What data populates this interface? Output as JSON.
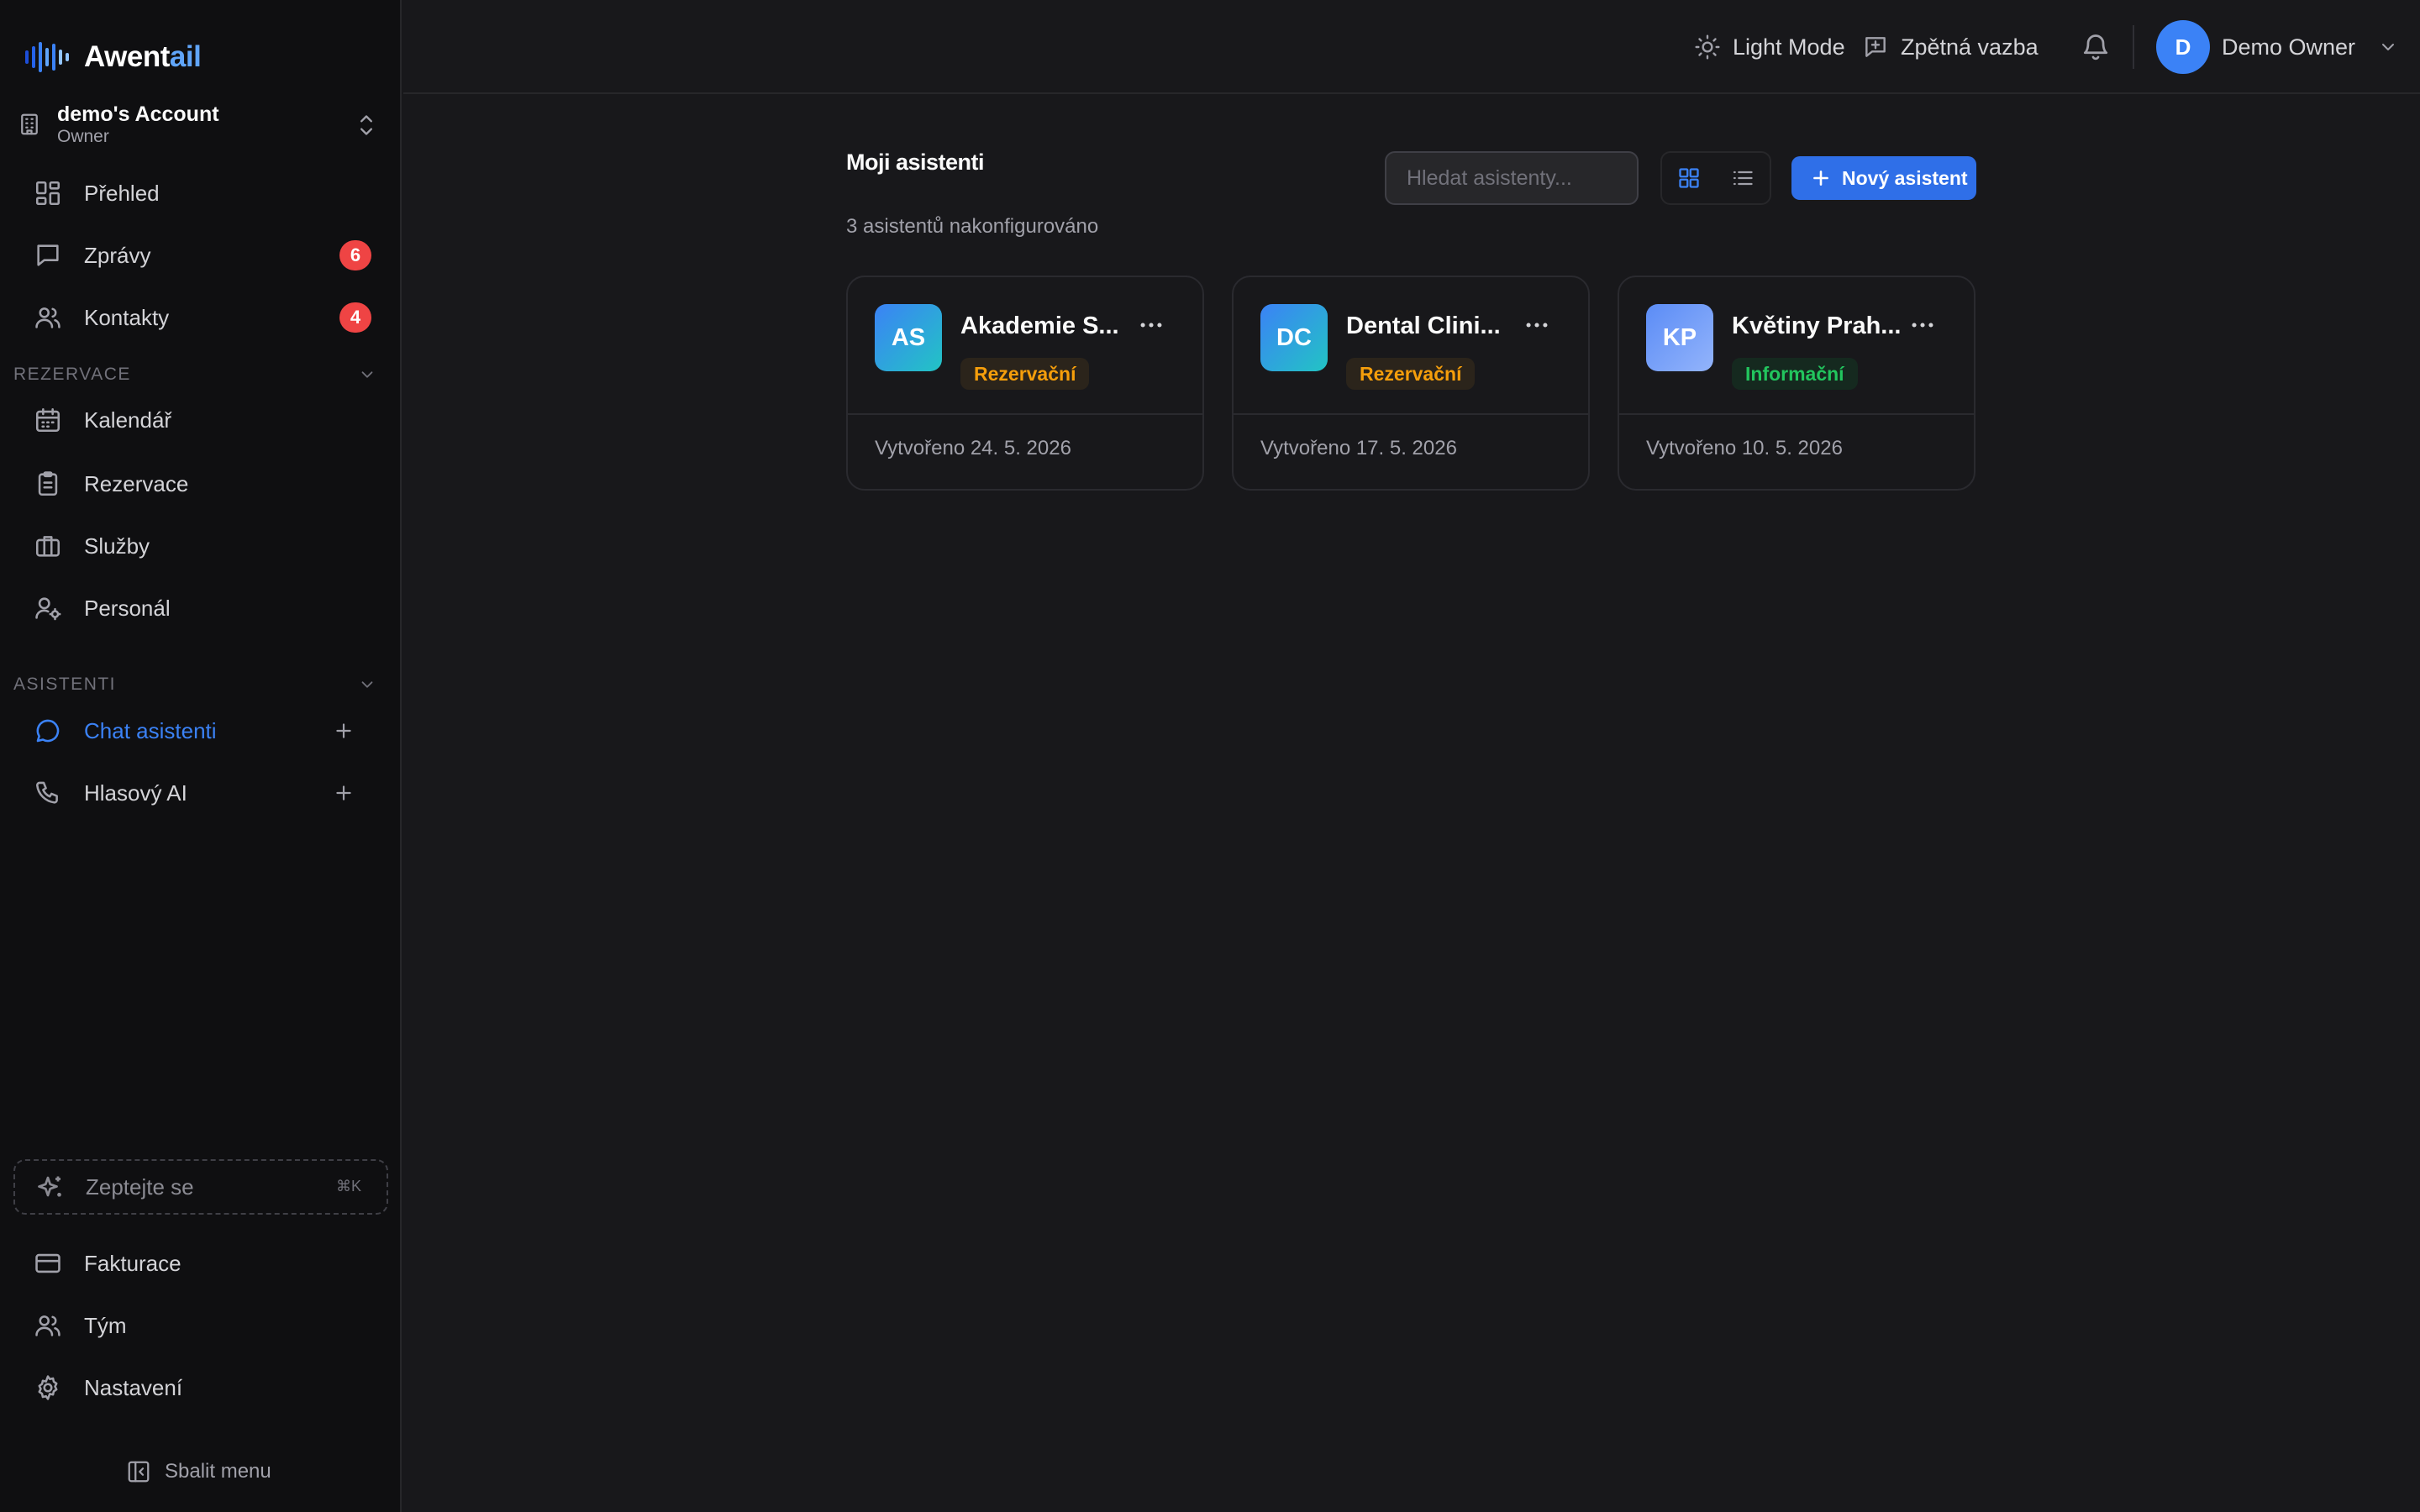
{
  "brand": {
    "name_main": "Awent",
    "name_accent": "ail",
    "accent_color": "#3b82f6"
  },
  "account": {
    "name": "demo's Account",
    "role": "Owner"
  },
  "nav": {
    "main": [
      {
        "label": "Přehled",
        "icon": "layout-grid-icon"
      },
      {
        "label": "Zprávy",
        "icon": "message-square-icon",
        "badge": "6"
      },
      {
        "label": "Kontakty",
        "icon": "users-icon",
        "badge": "4"
      }
    ],
    "section_booking": "REZERVACE",
    "booking": [
      {
        "label": "Kalendář",
        "icon": "calendar-icon"
      },
      {
        "label": "Rezervace",
        "icon": "clipboard-list-icon"
      },
      {
        "label": "Služby",
        "icon": "briefcase-icon"
      },
      {
        "label": "Personál",
        "icon": "user-cog-icon"
      }
    ],
    "section_assistants": "ASISTENTI",
    "assistants": [
      {
        "label": "Chat asistenti",
        "icon": "message-circle-icon",
        "active": true
      },
      {
        "label": "Hlasový AI",
        "icon": "phone-icon"
      }
    ],
    "ask": {
      "label": "Zeptejte se",
      "shortcut": "⌘K"
    },
    "bottom": [
      {
        "label": "Fakturace",
        "icon": "credit-card-icon"
      },
      {
        "label": "Tým",
        "icon": "users-icon"
      },
      {
        "label": "Nastavení",
        "icon": "settings-gear-icon"
      }
    ],
    "collapse_label": "Sbalit menu"
  },
  "header": {
    "theme_label": "Light Mode",
    "feedback_label": "Zpětná vazba",
    "user_initial": "D",
    "user_name": "Demo Owner"
  },
  "main": {
    "title": "Moji asistenti",
    "subtitle": "3 asistentů nakonfigurováno",
    "search_placeholder": "Hledat asistenty...",
    "new_button_label": "Nový asistent",
    "view_mode": "grid",
    "assistants": [
      {
        "initials": "AS",
        "name": "Akademie S...",
        "tag": "Rezervační",
        "tag_type": "booking",
        "created": "Vytvořeno 24. 5. 2026"
      },
      {
        "initials": "DC",
        "name": "Dental Clini...",
        "tag": "Rezervační",
        "tag_type": "booking",
        "created": "Vytvořeno 17. 5. 2026"
      },
      {
        "initials": "KP",
        "name": "Květiny Prah...",
        "tag": "Informační",
        "tag_type": "info",
        "created": "Vytvořeno 10. 5. 2026"
      }
    ]
  }
}
